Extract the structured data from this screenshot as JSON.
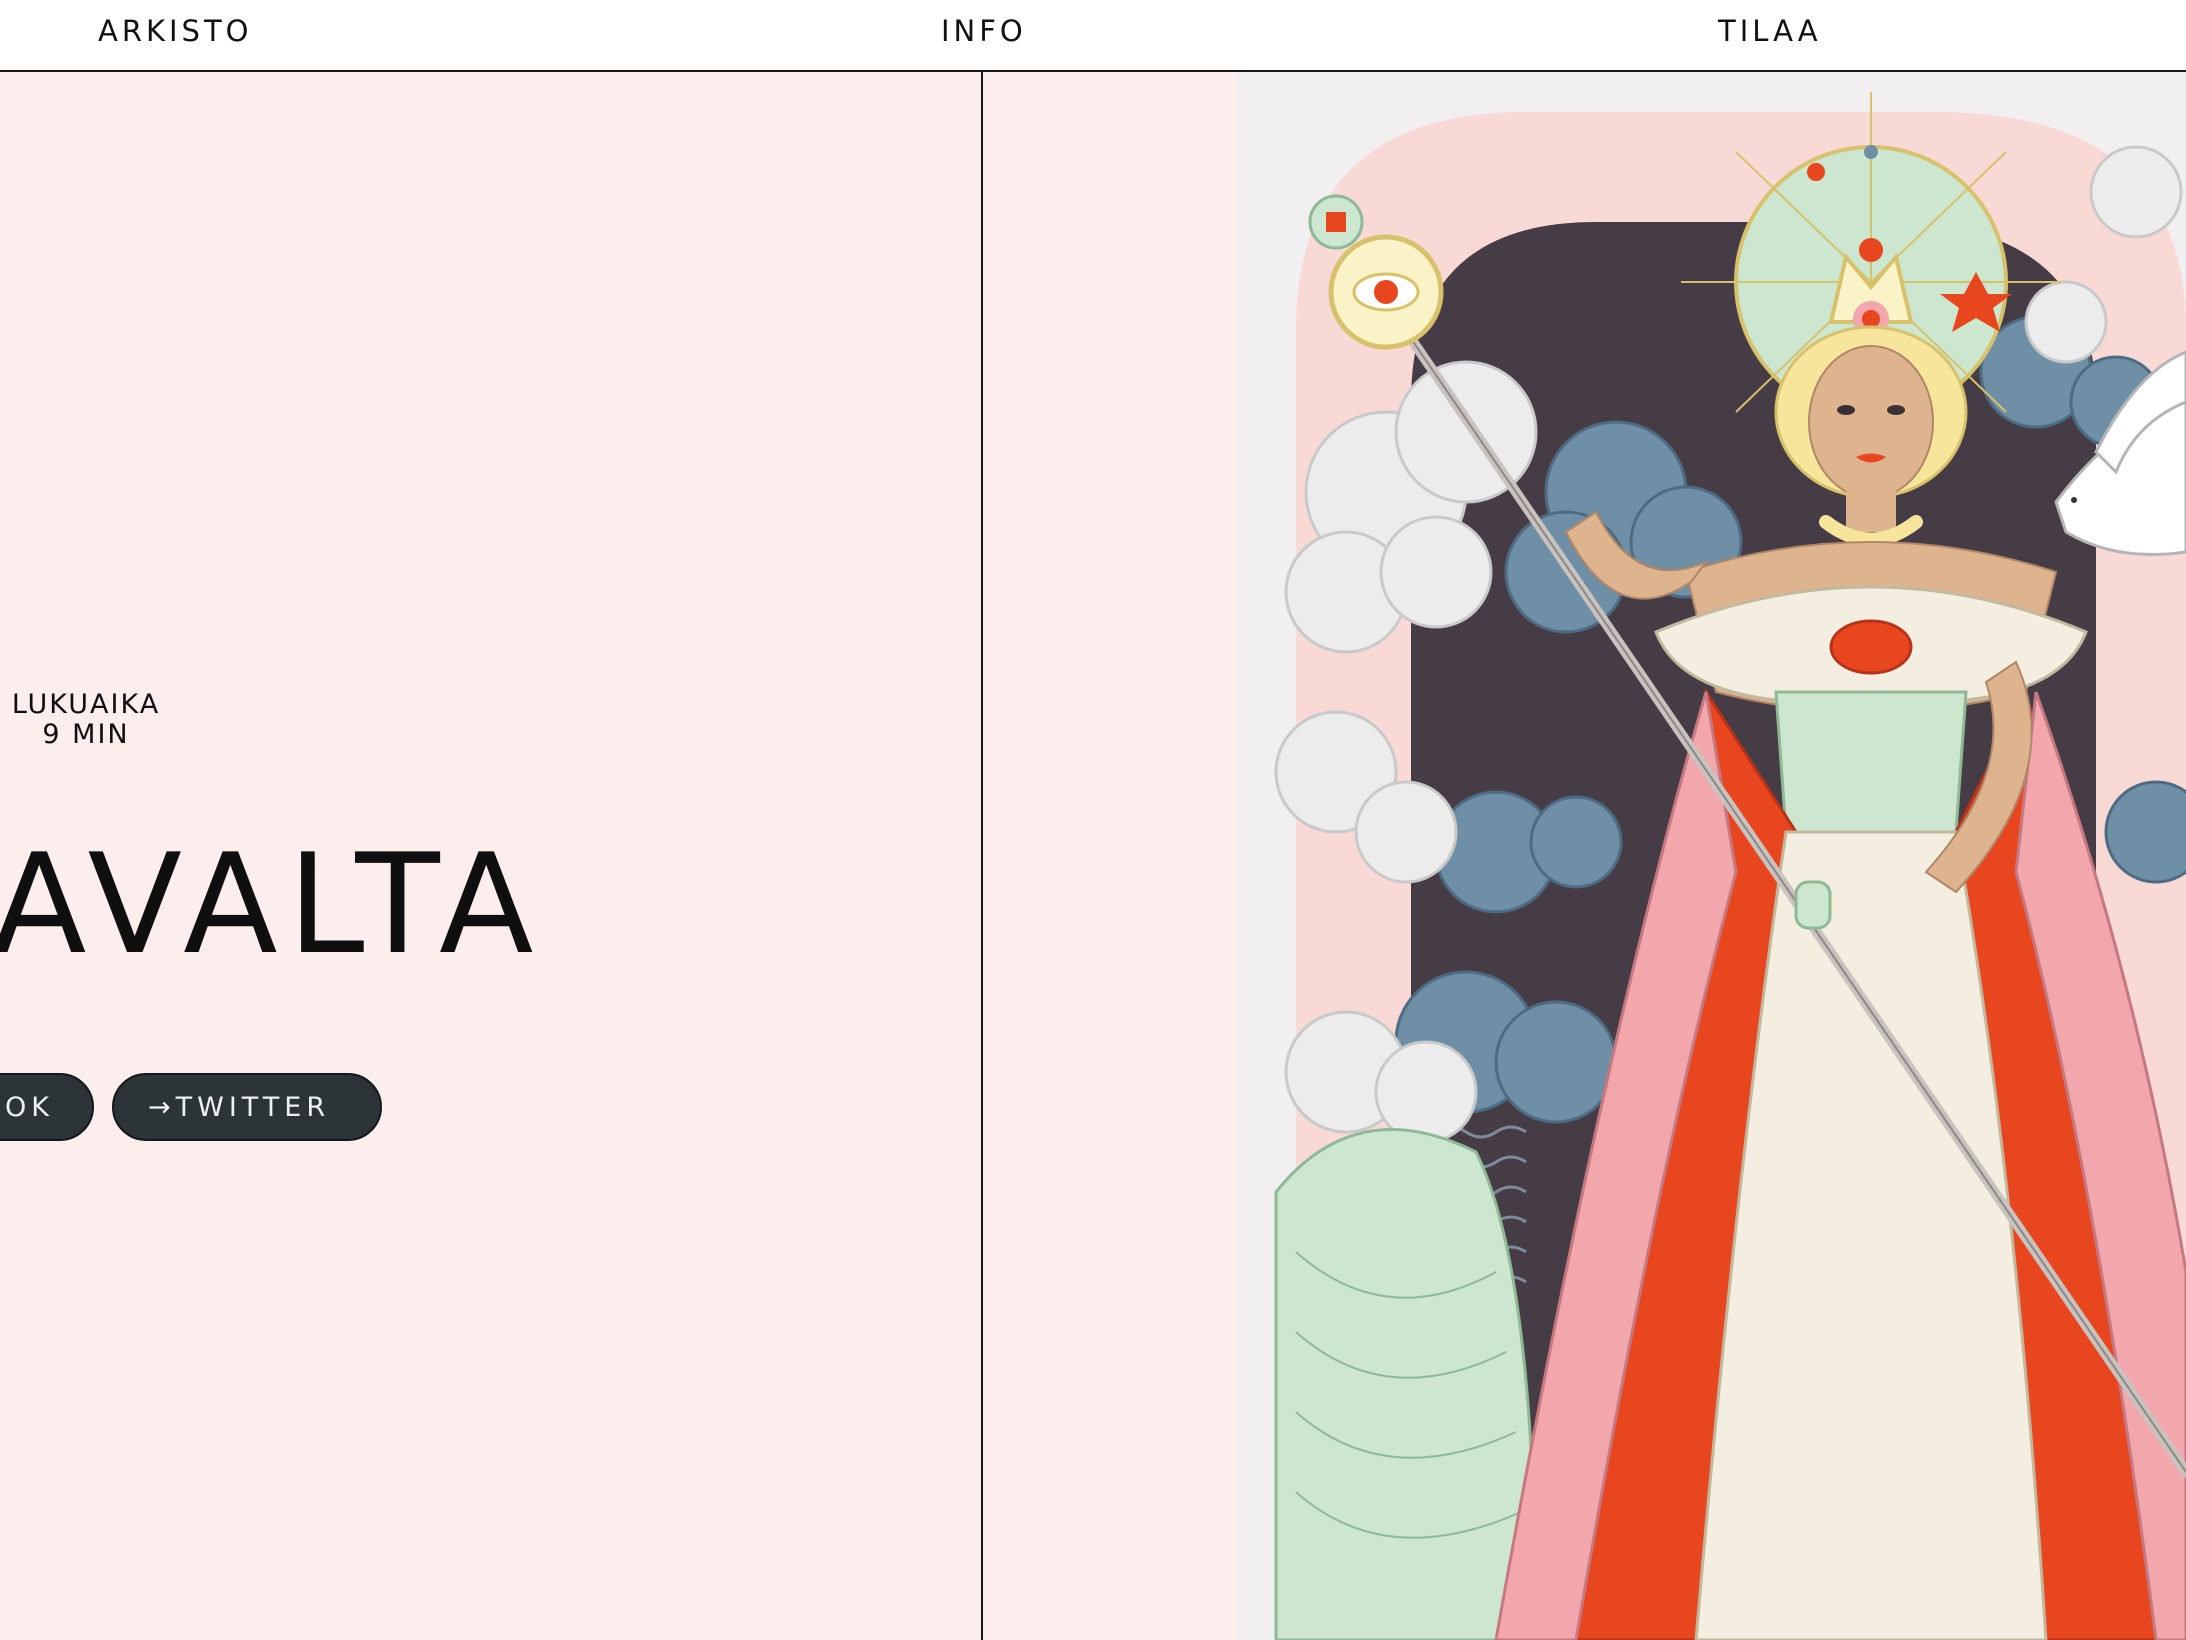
{
  "nav": {
    "items": [
      {
        "label": "ARKISTO"
      },
      {
        "label": "INFO"
      },
      {
        "label": "TILAA"
      }
    ]
  },
  "article": {
    "reading_time_label": "LUKUAIKA",
    "reading_time_value": "9 MIN",
    "title_visible": "AVALTA"
  },
  "share": {
    "facebook_label": "OK",
    "twitter_label": "→TWITTER"
  },
  "colors": {
    "page_bg": "#fbeeed",
    "button_bg": "#2d3438",
    "accent_red": "#e8461f",
    "mint": "#cfe8d2",
    "pink": "#f2a7ad"
  },
  "illustration": {
    "icon": "queen-illustration"
  }
}
